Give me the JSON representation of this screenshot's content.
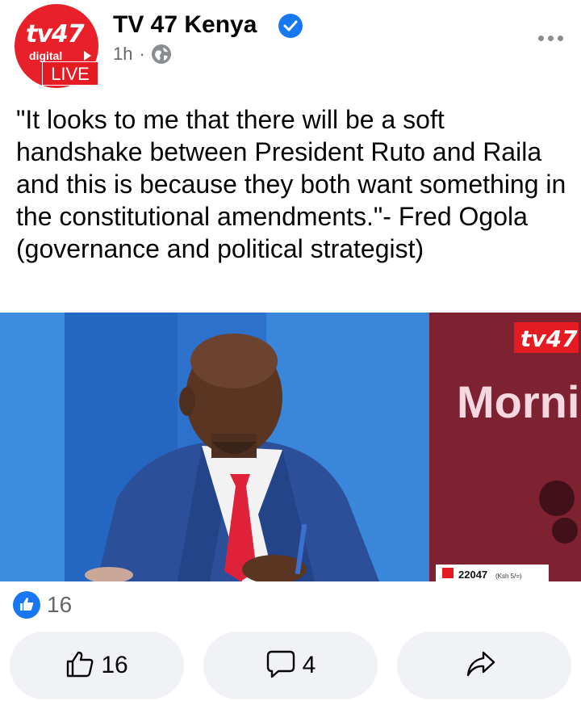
{
  "post": {
    "page_name": "TV 47 Kenya",
    "time": "1h",
    "separator": "·",
    "privacy_icon": "globe-icon",
    "verified_icon": "verified-badge-icon",
    "avatar": {
      "logo_text": "tv47",
      "logo_sub": "digital",
      "live_label": "LIVE"
    },
    "text": "\"It looks to me that there will be a soft handshake between President Ruto and Raila and this is because they both want something in the constitutional amendments.\"- Fred Ogola (governance and political strategist)",
    "image": {
      "channel_logo": "tv47",
      "show_text": "Morni",
      "ticker_number": "22047",
      "ticker_sub": "(Ksh 5/=)"
    }
  },
  "reactions": {
    "icon": "like-reaction-icon",
    "count": "16"
  },
  "actions": {
    "like": {
      "icon": "thumbs-up-icon",
      "label": "16"
    },
    "comment": {
      "icon": "comment-icon",
      "label": "4"
    },
    "share": {
      "icon": "share-icon",
      "label": ""
    }
  },
  "colors": {
    "brand_red": "#e41b23",
    "facebook_blue": "#1877f2",
    "button_bg": "#f0f2f5",
    "meta_gray": "#65676b"
  }
}
